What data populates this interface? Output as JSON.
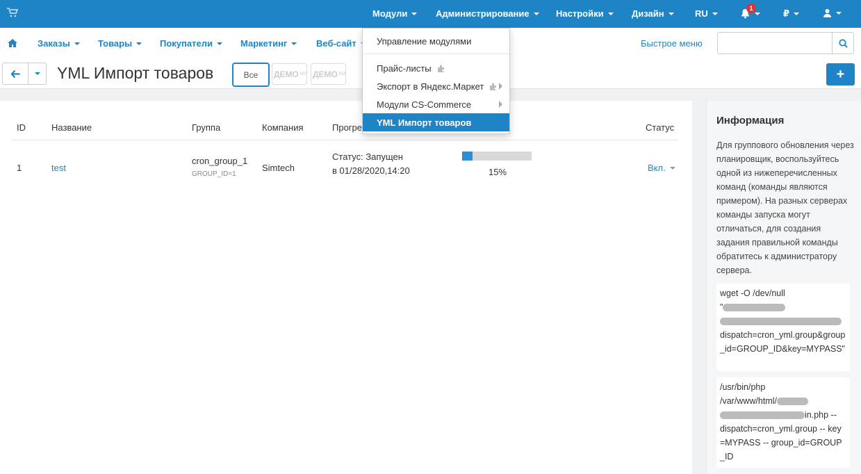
{
  "topbar": {
    "menu": [
      {
        "label": "Модули",
        "active": true
      },
      {
        "label": "Администрирование"
      },
      {
        "label": "Настройки"
      },
      {
        "label": "Дизайн"
      },
      {
        "label": "RU"
      }
    ],
    "notifications_count": "1",
    "currency": "₽",
    "brand_color": "#1f84c6"
  },
  "subnav": {
    "items": [
      "Заказы",
      "Товары",
      "Покупатели",
      "Маркетинг",
      "Веб-сайт"
    ],
    "quick_menu": "Быстрое меню",
    "search_placeholder": ""
  },
  "titlebar": {
    "title": "YML Импорт товаров",
    "tab_all": "Все",
    "tab_demo": "ДЕМО",
    "tab_demo_small": "МА"
  },
  "table": {
    "headers": [
      "ID",
      "Название",
      "Группа",
      "Компания",
      "Прогре",
      "Статус"
    ],
    "rows": [
      {
        "id": "1",
        "name": "test",
        "group": "cron_group_1",
        "group_id": "GROUP_ID=1",
        "company": "Simtech",
        "status_line1": "Статус: Запущен",
        "status_line2": "в 01/28/2020,14:20",
        "progress": 0.15,
        "progress_label": "15%",
        "state": "Вкл."
      }
    ]
  },
  "sidebar": {
    "title": "Информация",
    "text": "Для группового обновления через планировщик, воспользуйтесь одной из нижеперечисленных команд (команды являются примером). На разных серверах команды запуска могут отличаться, для создания задания правильной команды обратитесь к администратору сервера.",
    "cmd1_line1": "wget -O /dev/null",
    "cmd1_line2": "\"",
    "cmd1_tail": "dispatch=cron_yml.group&group_id=GROUP_ID&key=MYPASS\"",
    "cmd1_end": "min.php?",
    "cmd2_line1": "/usr/bin/php",
    "cmd2_line2": "/var/www/html/",
    "cmd2_mid": "in.php --",
    "cmd2_tail": "dispatch=cron_yml.group -- key=MYPASS -- group_id=GROUP_ID"
  },
  "dropdown": {
    "items": [
      "Управление модулями",
      "Прайс-листы",
      "Экспорт в Яндекс.Маркет",
      "Модули CS-Commerce",
      "YML Импорт товаров"
    ]
  }
}
